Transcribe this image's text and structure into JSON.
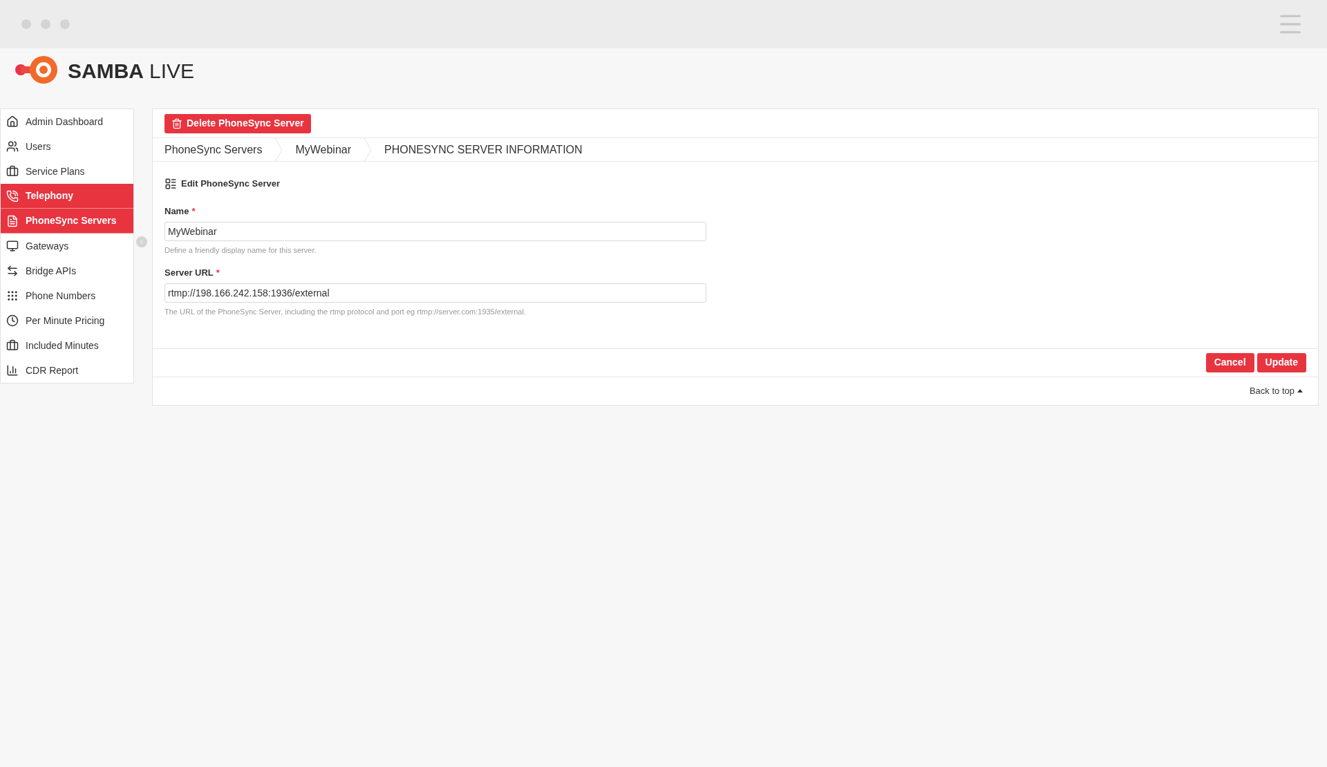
{
  "logo": {
    "name": "SAMBA",
    "suffix": "LIVE"
  },
  "sidebar": {
    "items": [
      {
        "label": "Admin Dashboard",
        "selected": false
      },
      {
        "label": "Users",
        "selected": false
      },
      {
        "label": "Service Plans",
        "selected": false
      },
      {
        "label": "Telephony",
        "selected": true
      },
      {
        "label": "PhoneSync Servers",
        "selected": true
      },
      {
        "label": "Gateways",
        "selected": false
      },
      {
        "label": "Bridge APIs",
        "selected": false
      },
      {
        "label": "Phone Numbers",
        "selected": false
      },
      {
        "label": "Per Minute Pricing",
        "selected": false
      },
      {
        "label": "Included Minutes",
        "selected": false
      },
      {
        "label": "CDR Report",
        "selected": false
      }
    ]
  },
  "toolbar": {
    "delete_button": "Delete PhoneSync Server"
  },
  "breadcrumb": [
    "PhoneSync Servers",
    "MyWebinar",
    "PHONESYNC SERVER INFORMATION"
  ],
  "form": {
    "title": "Edit PhoneSync Server",
    "fields": [
      {
        "label": "Name",
        "required": "*",
        "value": "MyWebinar",
        "help": "Define a friendly display name for this server."
      },
      {
        "label": "Server URL",
        "required": "*",
        "value": "rtmp://198.166.242.158:1936/external",
        "help": "The URL of the PhoneSync Server, including the rtmp protocol and port eg rtmp://server.com:1935/external."
      }
    ]
  },
  "actions": [
    "Cancel",
    "Update"
  ],
  "back_to_top": "Back to top"
}
